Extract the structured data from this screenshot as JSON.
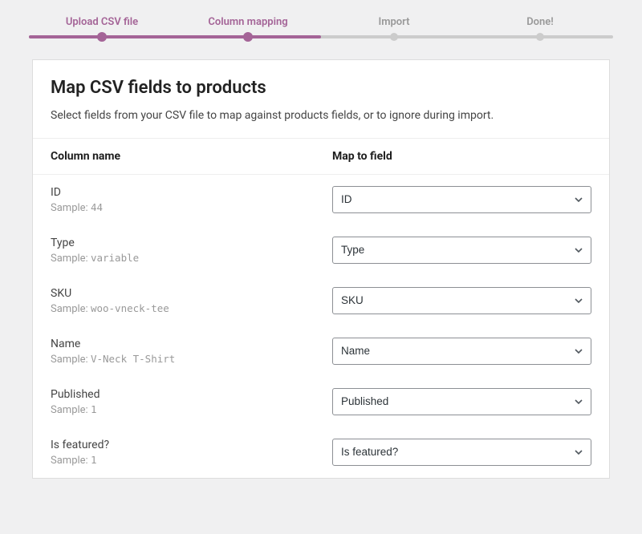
{
  "progress": {
    "steps": [
      {
        "label": "Upload CSV file",
        "state": "done"
      },
      {
        "label": "Column mapping",
        "state": "active"
      },
      {
        "label": "Import",
        "state": "todo"
      },
      {
        "label": "Done!",
        "state": "todo"
      }
    ],
    "fill_percent": 50
  },
  "header": {
    "title": "Map CSV fields to products",
    "description": "Select fields from your CSV file to map against products fields, or to ignore during import."
  },
  "columns": {
    "left_label": "Column name",
    "right_label": "Map to field",
    "sample_prefix": "Sample:"
  },
  "rows": [
    {
      "name": "ID",
      "sample": "44",
      "field": "ID"
    },
    {
      "name": "Type",
      "sample": "variable",
      "field": "Type"
    },
    {
      "name": "SKU",
      "sample": "woo-vneck-tee",
      "field": "SKU"
    },
    {
      "name": "Name",
      "sample": "V-Neck T-Shirt",
      "field": "Name"
    },
    {
      "name": "Published",
      "sample": "1",
      "field": "Published"
    },
    {
      "name": "Is featured?",
      "sample": "1",
      "field": "Is featured?"
    }
  ]
}
